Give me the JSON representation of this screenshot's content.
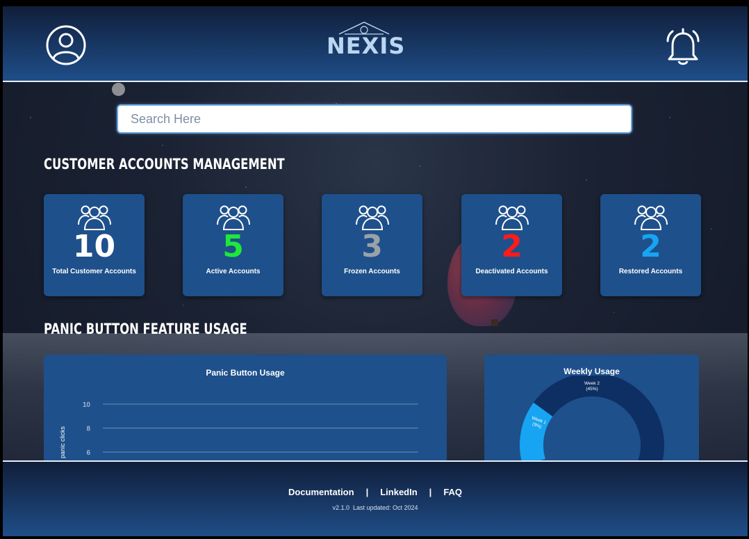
{
  "header": {
    "logo_text": "NEXIS",
    "profile_icon": "user-circle-icon",
    "notification_icon": "bell-icon"
  },
  "search": {
    "placeholder": "Search Here",
    "value": ""
  },
  "accounts_section": {
    "title": "CUSTOMER ACCOUNTS MANAGEMENT",
    "cards": [
      {
        "value": "10",
        "label": "Total Customer Accounts",
        "color": "#ffffff",
        "icon": "users-icon"
      },
      {
        "value": "5",
        "label": "Active Accounts",
        "color": "#1ee83a",
        "icon": "users-icon"
      },
      {
        "value": "3",
        "label": "Frozen Accounts",
        "color": "#9aa1a9",
        "icon": "users-icon"
      },
      {
        "value": "2",
        "label": "Deactivated Accounts",
        "color": "#ff1b1b",
        "icon": "users-icon"
      },
      {
        "value": "2",
        "label": "Restored Accounts",
        "color": "#17a4f2",
        "icon": "users-icon"
      }
    ]
  },
  "panic_section": {
    "title": "PANIC BUTTON FEATURE USAGE"
  },
  "chart_data": [
    {
      "type": "bar",
      "title": "Panic Button Usage",
      "ylabel": "panic clicks",
      "yticks_visible": [
        "10",
        "8",
        "6"
      ],
      "grid": true
    },
    {
      "type": "pie",
      "title": "Weekly Usage",
      "slices": [
        {
          "label": "Week 1",
          "percent_label": "(9%)",
          "value": 9,
          "color": "#17a4f2"
        },
        {
          "label": "Week 2",
          "percent_label": "(45%)",
          "value": 45,
          "color": "#0e2f63"
        }
      ]
    }
  ],
  "footer": {
    "links": [
      "Documentation",
      "LinkedIn",
      "FAQ"
    ],
    "separator": "|",
    "version": "v2.1.0",
    "updated": "Last updated: Oct 2024"
  }
}
